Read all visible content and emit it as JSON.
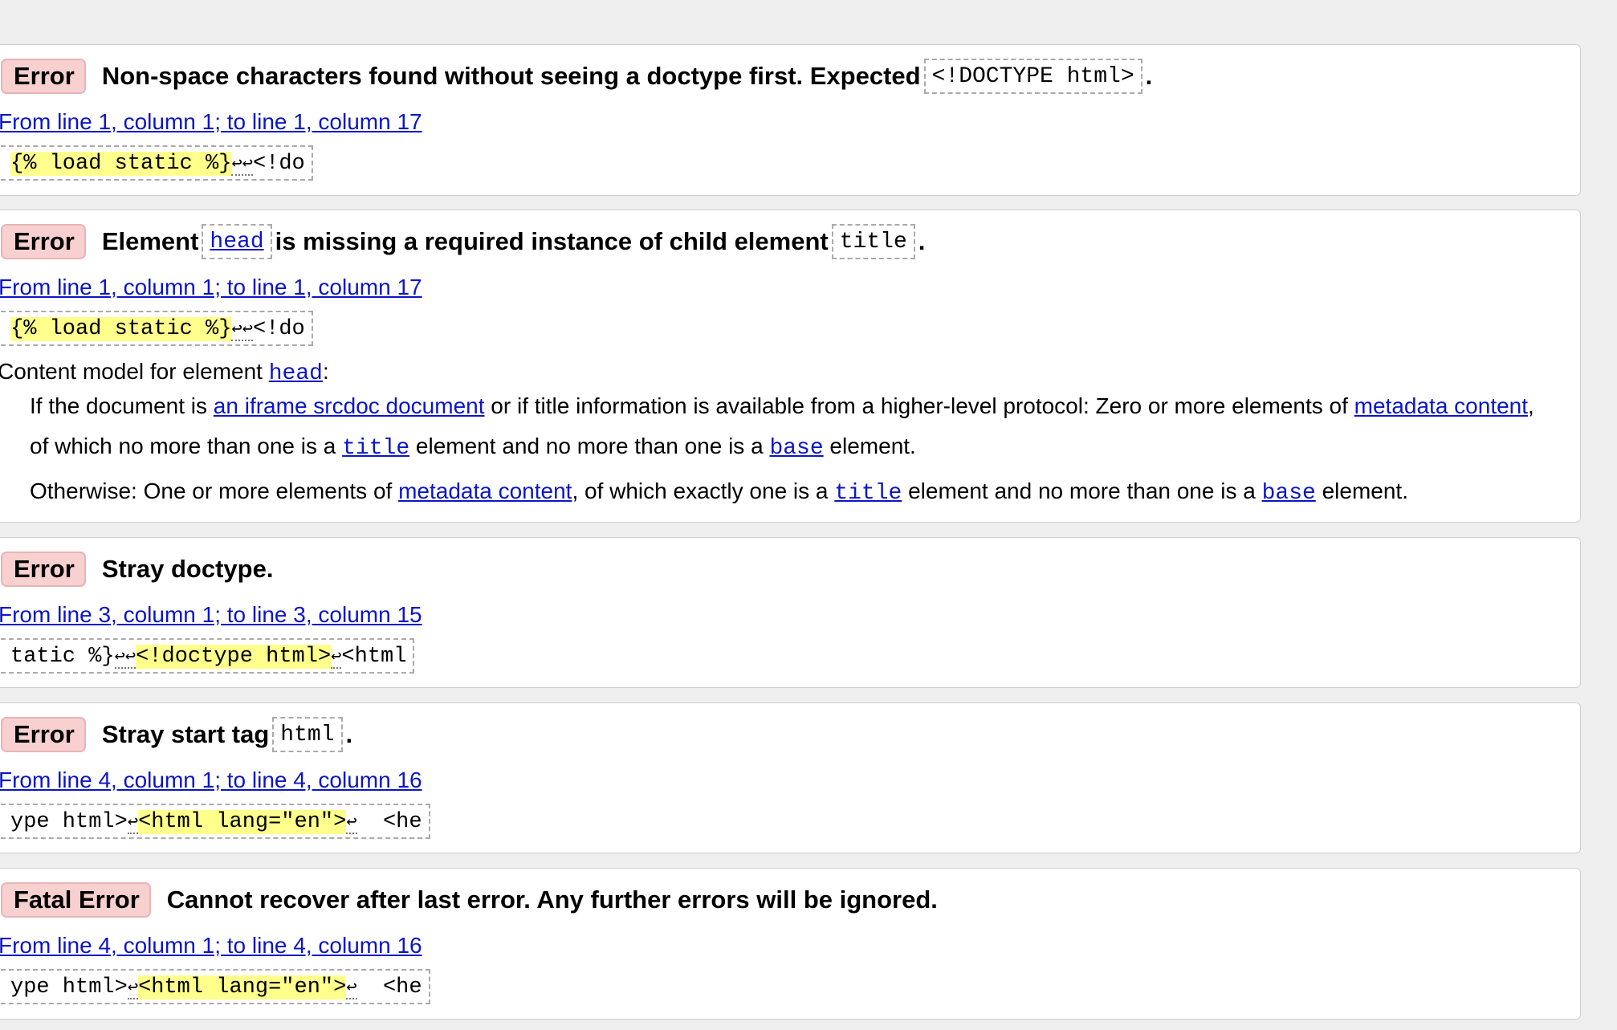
{
  "messages": [
    {
      "badge": "Error",
      "pre": "Non-space characters found without seeing a doctype first. Expected ",
      "code": "<!DOCTYPE html>",
      "post": ".",
      "location": "From line 1, column 1; to line 1, column 17",
      "extract": {
        "hl": "{% load static %}",
        "ret": "↩↩",
        "tail": "<!do"
      }
    },
    {
      "badge": "Error",
      "pre": "Element ",
      "code": "head",
      "mid": " is missing a required instance of child element ",
      "code2": "title",
      "post": ".",
      "location": "From line 1, column 1; to line 1, column 17",
      "extract": {
        "hl": "{% load static %}",
        "ret": "↩↩",
        "tail": "<!do"
      },
      "content_model": {
        "label": "Content model for element ",
        "element": "head",
        "colon": ":",
        "line1_a": "If the document is ",
        "line1_link": "an iframe srcdoc document",
        "line1_b": " or if title information is available from a higher-level protocol: Zero or more elements of ",
        "line1_link2": "metadata content",
        "line1_c": ",",
        "line2_a": "of which no more than one is a ",
        "line2_code": "title",
        "line2_b": " element and no more than one is a ",
        "line2_code2": "base",
        "line2_c": " element.",
        "line3_a": "Otherwise: One or more elements of ",
        "line3_link": "metadata content",
        "line3_b": ", of which exactly one is a ",
        "line3_code": "title",
        "line3_c": " element and no more than one is a ",
        "line3_code2": "base",
        "line3_d": " element."
      }
    },
    {
      "badge": "Error",
      "pre": "Stray doctype.",
      "location": "From line 3, column 1; to line 3, column 15",
      "extract": {
        "lead": "tatic %}",
        "ret": "↩↩",
        "hl": "<!doctype html>",
        "ret2": "↩",
        "tail": "<html"
      }
    },
    {
      "badge": "Error",
      "pre": "Stray start tag ",
      "code": "html",
      "post": ".",
      "location": "From line 4, column 1; to line 4, column 16",
      "extract": {
        "lead": "ype html>",
        "ret": "↩",
        "hl": "<html lang=\"en\">",
        "ret2": "↩",
        "tail": "  <he"
      }
    },
    {
      "badge": "Fatal Error",
      "pre": "Cannot recover after last error. Any further errors will be ignored.",
      "location": "From line 4, column 1; to line 4, column 16",
      "extract": {
        "lead": "ype html>",
        "ret": "↩",
        "hl": "<html lang=\"en\">",
        "ret2": "↩",
        "tail": "  <he"
      }
    }
  ],
  "colors": {
    "badge_bg": "#f8d0d0",
    "link": "#0b15c8",
    "highlight": "#ffff8c",
    "page_bg": "#efefef"
  }
}
